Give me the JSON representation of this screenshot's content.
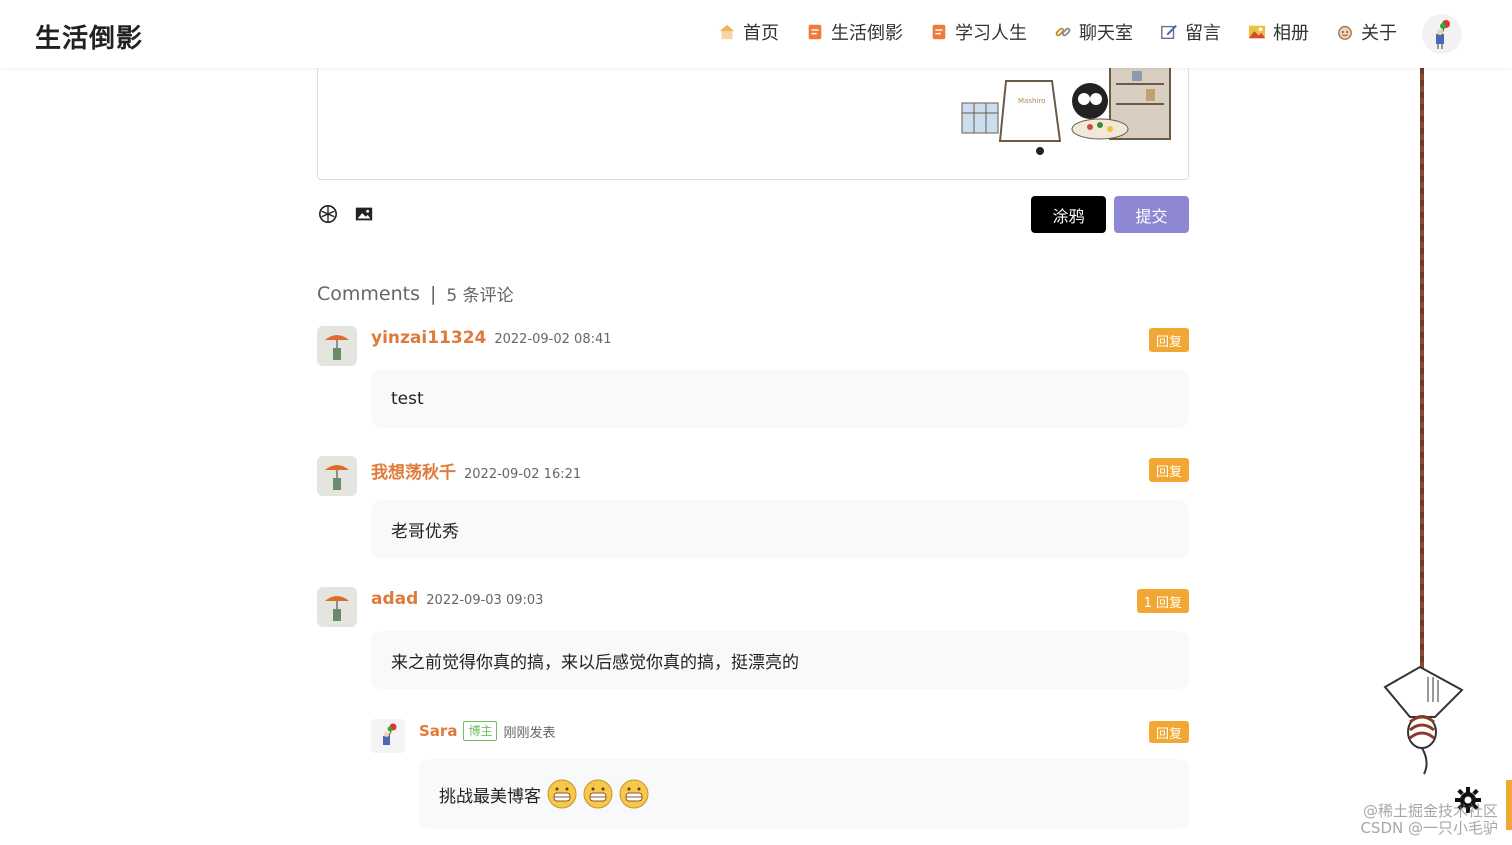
{
  "header": {
    "logo": "生活倒影",
    "nav": [
      {
        "label": "首页",
        "icon": "home-icon"
      },
      {
        "label": "生活倒影",
        "icon": "doc-icon"
      },
      {
        "label": "学习人生",
        "icon": "doc-icon"
      },
      {
        "label": "聊天室",
        "icon": "link-icon"
      },
      {
        "label": "留言",
        "icon": "edit-icon"
      },
      {
        "label": "相册",
        "icon": "image-icon"
      },
      {
        "label": "关于",
        "icon": "face-icon"
      }
    ]
  },
  "editor": {
    "doodle_label": "涂鸦",
    "submit_label": "提交"
  },
  "comments_header": {
    "title": "Comments",
    "separator": "|",
    "count": "5 条评论"
  },
  "comments": [
    {
      "username": "yinzai11324",
      "time": "2022-09-02 08:41",
      "reply": "回复",
      "content": "test"
    },
    {
      "username": "我想荡秋千",
      "time": "2022-09-02 16:21",
      "reply": "回复",
      "content": "老哥优秀"
    },
    {
      "username": "adad",
      "time": "2022-09-03 09:03",
      "reply": "1 回复",
      "content": "来之前觉得你真的搞，来以后感觉你真的搞，挺漂亮的"
    }
  ],
  "sub_comment": {
    "username": "Sara",
    "badge": "博主",
    "time": "刚刚发表",
    "reply": "回复",
    "content": "挑战最美博客"
  },
  "watermark": {
    "line1": "@稀土掘金技术社区",
    "line2": "CSDN @一只小毛驴"
  },
  "colors": {
    "accent": "#e07a3a",
    "reply": "#f0a733",
    "submit": "#8e87d4",
    "host_badge": "#6fbf5f"
  }
}
